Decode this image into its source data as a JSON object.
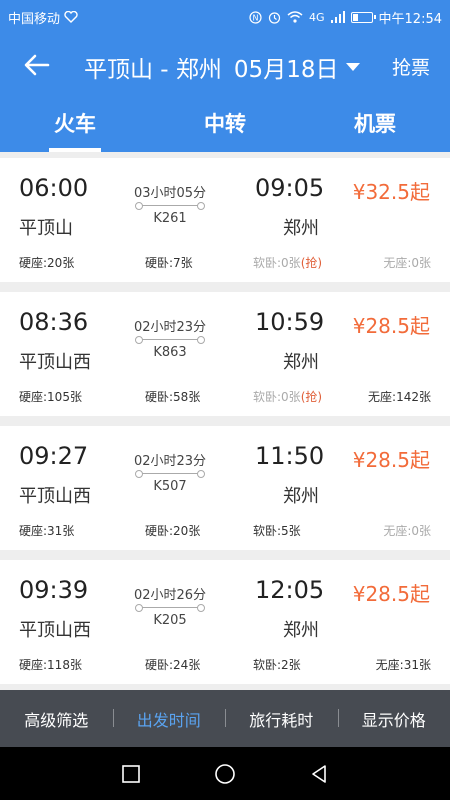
{
  "status_bar": {
    "carrier": "中国移动",
    "time": "中午12:54",
    "battery_level": 0.3,
    "network": "4G"
  },
  "header": {
    "route": "平顶山 - 郑州",
    "date": "05月18日",
    "grab_label": "抢票"
  },
  "tabs": [
    {
      "label": "火车",
      "active": true
    },
    {
      "label": "中转",
      "active": false
    },
    {
      "label": "机票",
      "active": false
    }
  ],
  "trains": [
    {
      "dep_time": "06:00",
      "dep_station": "平顶山",
      "duration": "03小时05分",
      "train_no": "K261",
      "arr_time": "09:05",
      "arr_station": "郑州",
      "price": "¥32.5起",
      "seats": [
        {
          "label": "硬座:20张",
          "available": true
        },
        {
          "label": "硬卧:7张",
          "available": true
        },
        {
          "label": "软卧:0张",
          "grab": "(抢)",
          "available": false
        },
        {
          "label": "无座:0张",
          "available": false
        }
      ]
    },
    {
      "dep_time": "08:36",
      "dep_station": "平顶山西",
      "duration": "02小时23分",
      "train_no": "K863",
      "arr_time": "10:59",
      "arr_station": "郑州",
      "price": "¥28.5起",
      "seats": [
        {
          "label": "硬座:105张",
          "available": true
        },
        {
          "label": "硬卧:58张",
          "available": true
        },
        {
          "label": "软卧:0张",
          "grab": "(抢)",
          "available": false
        },
        {
          "label": "无座:142张",
          "available": true
        }
      ]
    },
    {
      "dep_time": "09:27",
      "dep_station": "平顶山西",
      "duration": "02小时23分",
      "train_no": "K507",
      "arr_time": "11:50",
      "arr_station": "郑州",
      "price": "¥28.5起",
      "seats": [
        {
          "label": "硬座:31张",
          "available": true
        },
        {
          "label": "硬卧:20张",
          "available": true
        },
        {
          "label": "软卧:5张",
          "available": true
        },
        {
          "label": "无座:0张",
          "available": false
        }
      ]
    },
    {
      "dep_time": "09:39",
      "dep_station": "平顶山西",
      "duration": "02小时26分",
      "train_no": "K205",
      "arr_time": "12:05",
      "arr_station": "郑州",
      "price": "¥28.5起",
      "seats": [
        {
          "label": "硬座:118张",
          "available": true
        },
        {
          "label": "硬卧:24张",
          "available": true
        },
        {
          "label": "软卧:2张",
          "available": true
        },
        {
          "label": "无座:31张",
          "available": true
        }
      ]
    }
  ],
  "filter_bar": [
    {
      "label": "高级筛选",
      "active": false
    },
    {
      "label": "出发时间",
      "active": true
    },
    {
      "label": "旅行耗时",
      "active": false
    },
    {
      "label": "显示价格",
      "active": false
    }
  ],
  "colors": {
    "brand": "#3d8be8",
    "price": "#f26b3a",
    "filter_active": "#5aa3f0"
  },
  "icons": {
    "back": "arrow-left-icon",
    "dropdown": "caret-down-icon",
    "nav": [
      "square-recents-icon",
      "circle-home-icon",
      "triangle-back-icon"
    ]
  }
}
